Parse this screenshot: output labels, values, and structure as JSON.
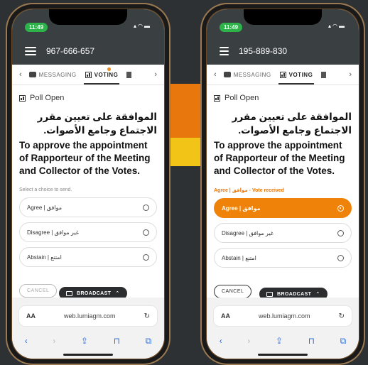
{
  "phones": [
    {
      "status_time": "11:49",
      "phone_number": "967-666-657",
      "tabs": [
        "MESSAGING",
        "VOTING"
      ],
      "poll_status": "Poll Open",
      "question_ar": "الموافقة على تعيين مقرر الاجتماع وجامع الأصوات.",
      "question_en": "To approve the appointment of Rapporteur of the Meeting and Collector of the Votes.",
      "hint": "Select a choice to send.",
      "choices": [
        "Agree | موافق",
        "Disagree | غير موافق",
        "Abstain | امتنع"
      ],
      "cancel_label": "CANCEL",
      "broadcast_label": "BROADCAST",
      "url": "web.lumiagm.com",
      "aa_label": "AA"
    },
    {
      "status_time": "11:49",
      "phone_number": "195-889-830",
      "tabs": [
        "MESSAGING",
        "VOTING"
      ],
      "poll_status": "Poll Open",
      "question_ar": "الموافقة على تعيين مقرر الاجتماع وجامع الأصوات.",
      "question_en": "To approve the appointment of Rapporteur of the Meeting and Collector of the Votes.",
      "hint": "Agree | موافق - Vote received",
      "choices": [
        "Agree | موافق",
        "Disagree | غير موافق",
        "Abstain | امتنع"
      ],
      "selected_choice": "Agree | موافق",
      "cancel_label": "CANCEL",
      "broadcast_label": "BROADCAST",
      "url": "web.lumiagm.com",
      "aa_label": "AA"
    }
  ],
  "colors": {
    "accent": "#ef8209",
    "appbar": "#3a3f42",
    "status_pill": "#2db34a"
  },
  "icons": [
    "hamburger-icon",
    "chat-icon",
    "bar-chart-icon",
    "document-icon",
    "cast-icon",
    "chevron-up-icon",
    "reload-icon",
    "share-icon",
    "bookmarks-icon",
    "tabs-icon"
  ]
}
